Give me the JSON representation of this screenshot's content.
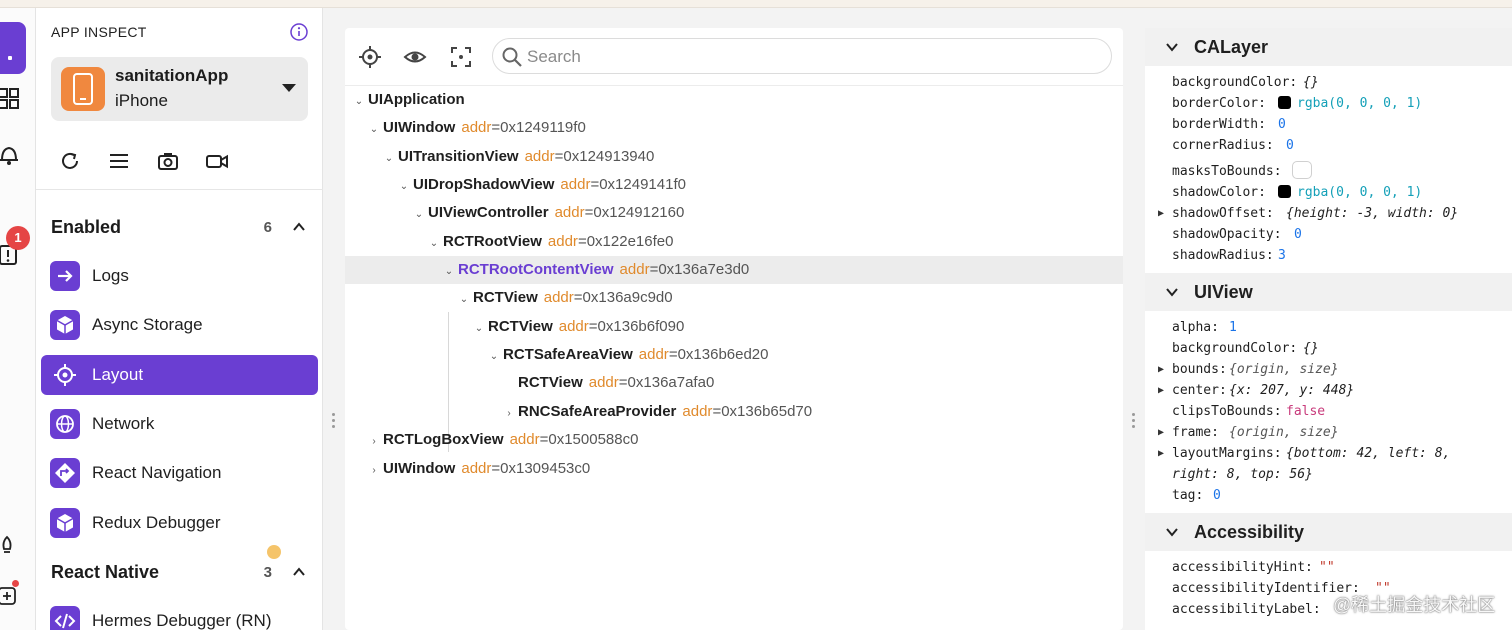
{
  "sidebar": {
    "header_title": "APP INSPECT",
    "rail_badge": "1",
    "device": {
      "name": "sanitationApp",
      "platform": "iPhone"
    },
    "sections": [
      {
        "title": "Enabled",
        "count": "6"
      },
      {
        "title": "React Native",
        "count": "3"
      }
    ],
    "plugins": [
      {
        "label": "Logs",
        "icon": "arrow-right-icon"
      },
      {
        "label": "Async Storage",
        "icon": "cube-icon"
      },
      {
        "label": "Layout",
        "icon": "target-icon",
        "active": true
      },
      {
        "label": "Network",
        "icon": "globe-icon"
      },
      {
        "label": "React Navigation",
        "icon": "diamond-arrow-icon"
      },
      {
        "label": "Redux Debugger",
        "icon": "cube-icon"
      },
      {
        "label": "Hermes Debugger (RN)",
        "icon": "code-icon"
      }
    ]
  },
  "search": {
    "placeholder": "Search"
  },
  "tree": [
    {
      "name": "UIApplication",
      "addr_key": "",
      "addr_val": ""
    },
    {
      "name": "UIWindow",
      "addr_key": "addr",
      "addr_val": "=0x1249119f0"
    },
    {
      "name": "UITransitionView",
      "addr_key": "addr",
      "addr_val": "=0x124913940"
    },
    {
      "name": "UIDropShadowView",
      "addr_key": "addr",
      "addr_val": "=0x1249141f0"
    },
    {
      "name": "UIViewController",
      "addr_key": "addr",
      "addr_val": "=0x124912160"
    },
    {
      "name": "RCTRootView",
      "addr_key": "addr",
      "addr_val": "=0x122e16fe0"
    },
    {
      "name": "RCTRootContentView",
      "addr_key": "addr",
      "addr_val": "=0x136a7e3d0"
    },
    {
      "name": "RCTView",
      "addr_key": "addr",
      "addr_val": "=0x136a9c9d0"
    },
    {
      "name": "RCTView",
      "addr_key": "addr",
      "addr_val": "=0x136b6f090"
    },
    {
      "name": "RCTSafeAreaView",
      "addr_key": "addr",
      "addr_val": "=0x136b6ed20"
    },
    {
      "name": "RCTView",
      "addr_key": "addr",
      "addr_val": "=0x136a7afa0"
    },
    {
      "name": "RNCSafeAreaProvider",
      "addr_key": "addr",
      "addr_val": "=0x136b65d70"
    },
    {
      "name": "RCTLogBoxView",
      "addr_key": "addr",
      "addr_val": "=0x1500588c0"
    },
    {
      "name": "UIWindow",
      "addr_key": "addr",
      "addr_val": "=0x1309453c0"
    }
  ],
  "inspector": {
    "calayer": {
      "title": "CALayer",
      "props": [
        {
          "k": "backgroundColor:",
          "v": "{}"
        },
        {
          "k": "borderColor:",
          "v": "rgba(0, 0, 0, 1)"
        },
        {
          "k": "borderWidth:",
          "v": "0"
        },
        {
          "k": "cornerRadius:",
          "v": "0"
        },
        {
          "k": "masksToBounds:",
          "v": ""
        },
        {
          "k": "shadowColor:",
          "v": "rgba(0, 0, 0, 1)"
        },
        {
          "k": "shadowOffset:",
          "v": "{height: -3, width: 0}"
        },
        {
          "k": "shadowOpacity:",
          "v": "0"
        },
        {
          "k": "shadowRadius:",
          "v": "3"
        }
      ]
    },
    "uiview": {
      "title": "UIView",
      "props": [
        {
          "k": "alpha:",
          "v": "1"
        },
        {
          "k": "backgroundColor:",
          "v": "{}"
        },
        {
          "k": "bounds:",
          "v": "{origin, size}"
        },
        {
          "k": "center:",
          "v": "{x: 207, y: 448}"
        },
        {
          "k": "clipsToBounds:",
          "v": "false"
        },
        {
          "k": "frame:",
          "v": "{origin, size}"
        },
        {
          "k": "layoutMargins:",
          "v": "{bottom: 42, left: 8,"
        },
        {
          "k": "",
          "v": "right: 8, top: 56}"
        },
        {
          "k": "tag:",
          "v": "0"
        }
      ]
    },
    "accessibility": {
      "title": "Accessibility",
      "props": [
        {
          "k": "accessibilityHint:",
          "v": "\"\""
        },
        {
          "k": "accessibilityIdentifier:",
          "v": "\"\""
        },
        {
          "k": "accessibilityLabel:",
          "v": ""
        }
      ]
    }
  },
  "watermark": "@稀土掘金技术社区",
  "colors": {
    "accent": "#6a3ed2",
    "addr_key": "#e08a2c",
    "number": "#1a73e8",
    "bool": "#c83a7b"
  }
}
